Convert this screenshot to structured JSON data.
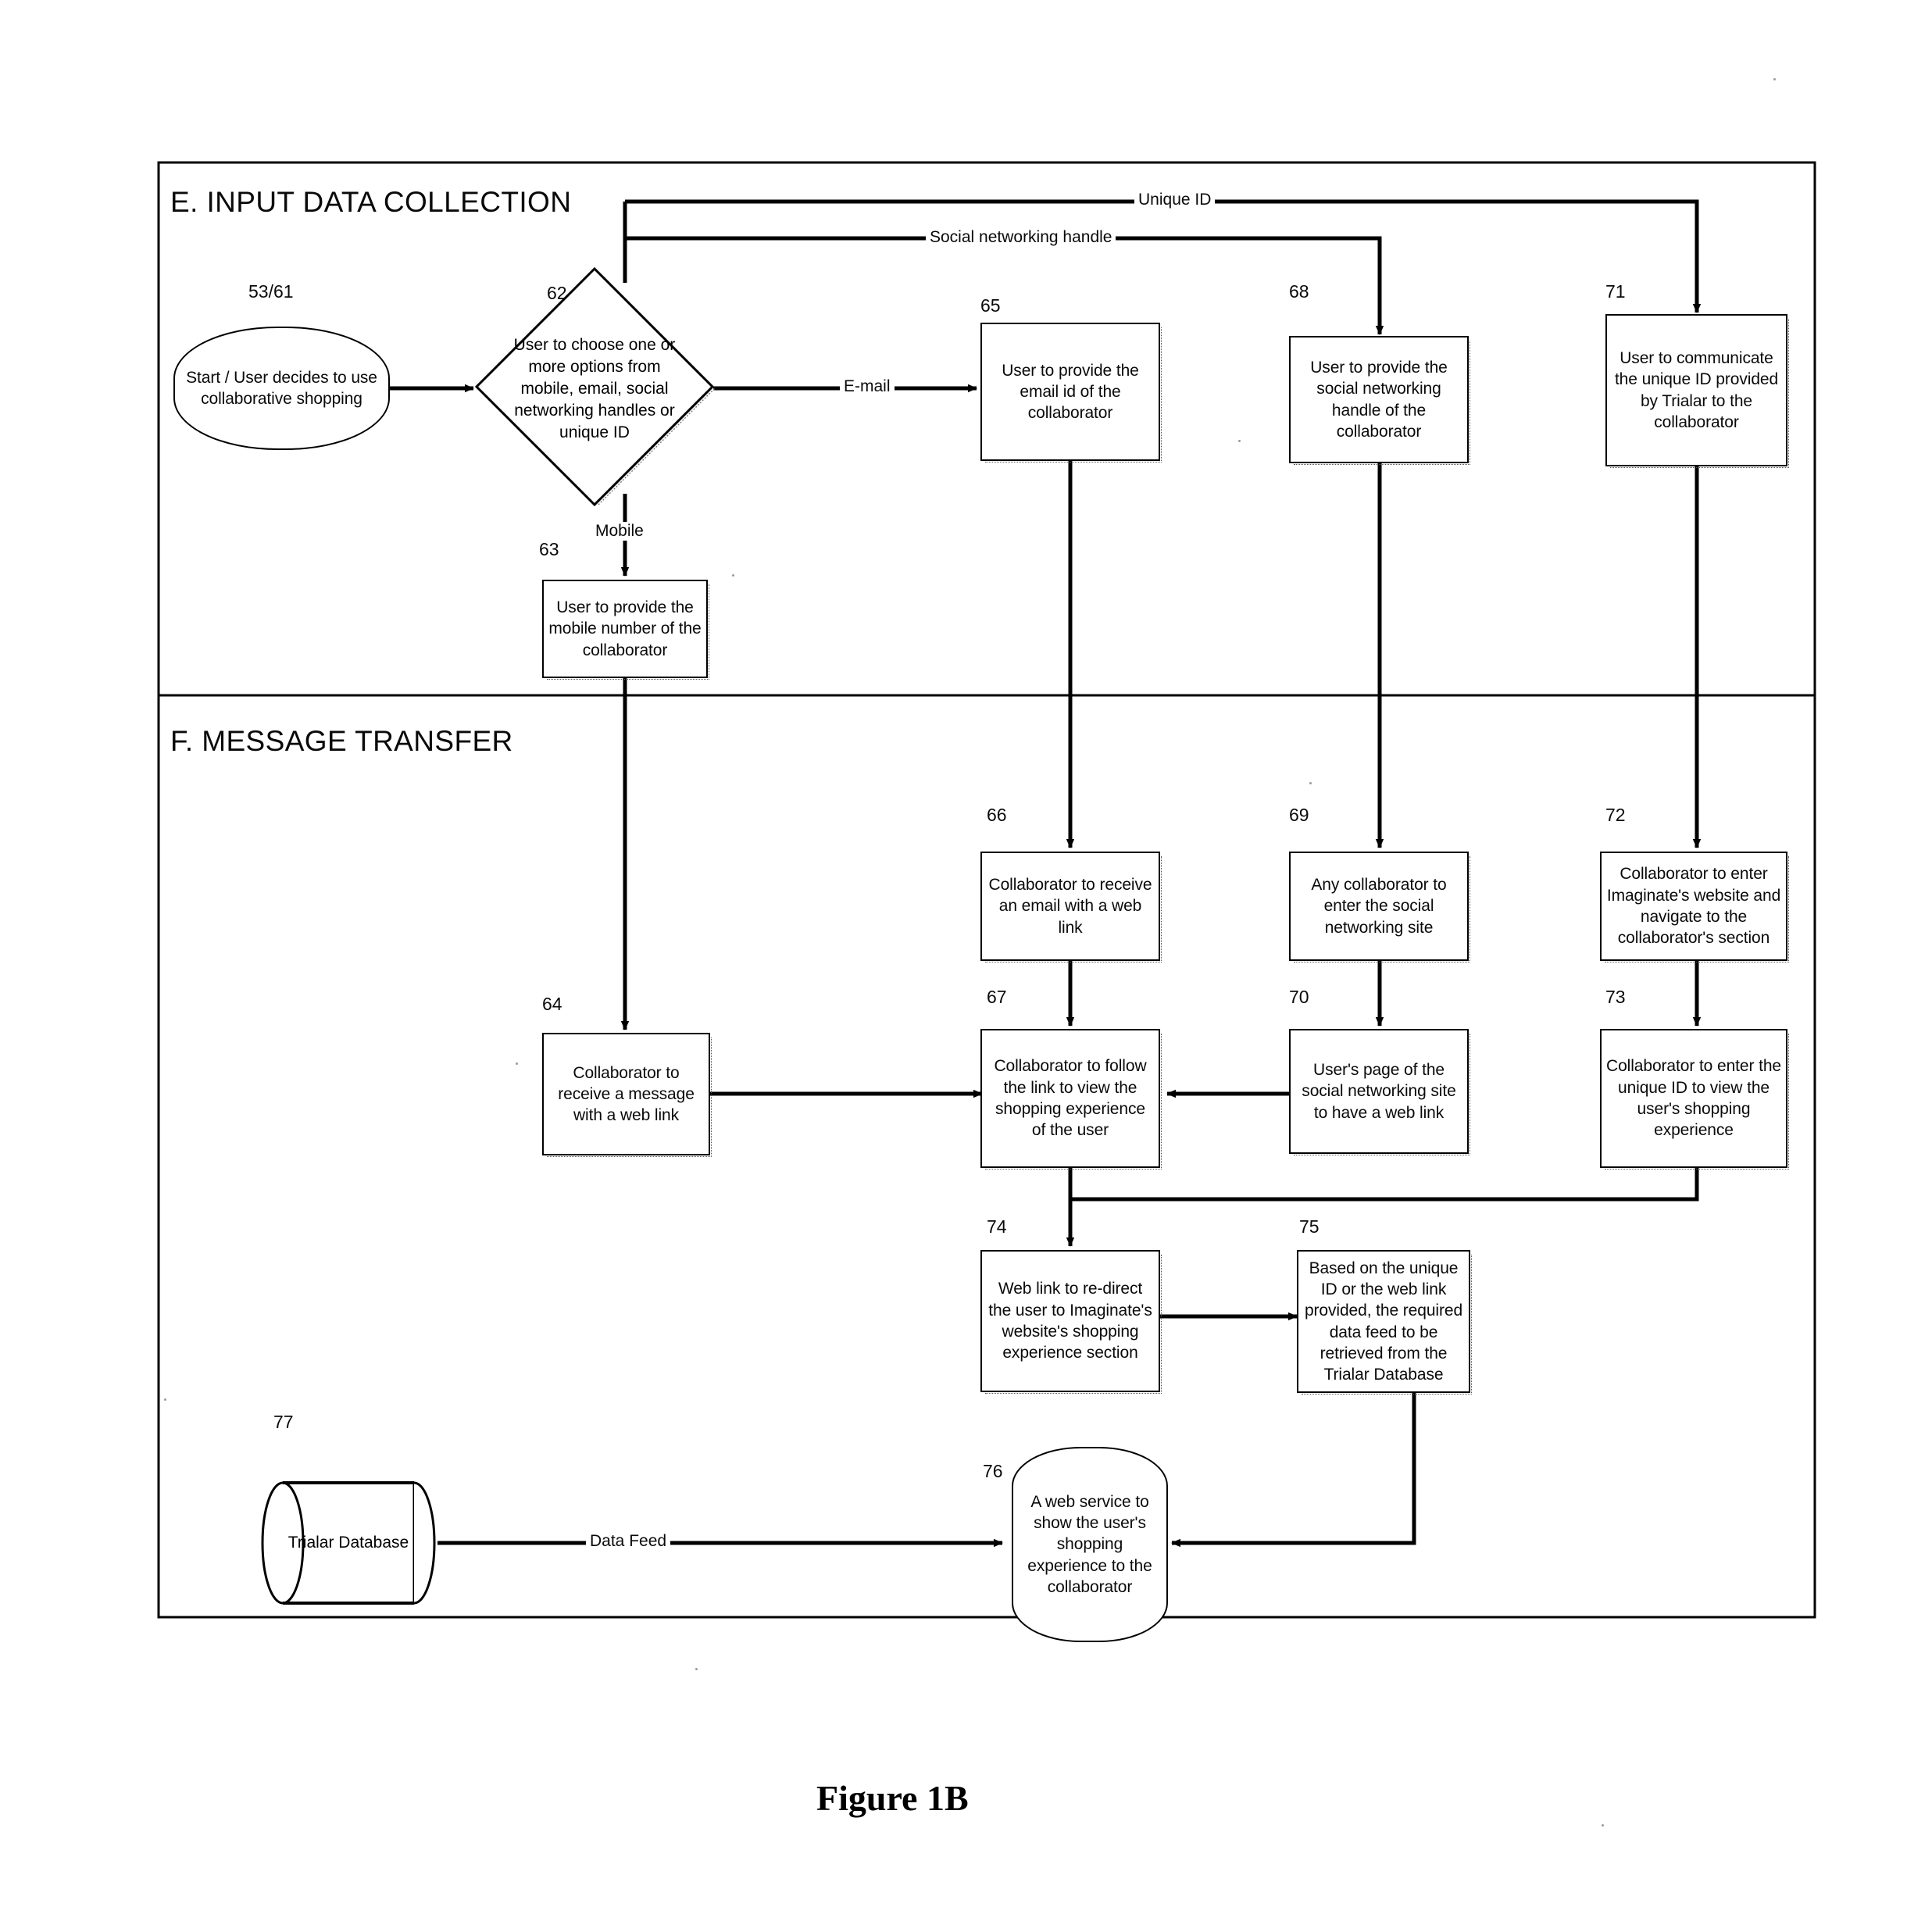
{
  "figure": {
    "caption": "Figure 1B"
  },
  "lanes": [
    {
      "id": "E",
      "title": "E. INPUT DATA COLLECTION"
    },
    {
      "id": "F",
      "title": "F. MESSAGE TRANSFER"
    }
  ],
  "nodes": [
    {
      "ref": "53/61",
      "shape": "terminator",
      "text": "Start / User decides to use collaborative shopping"
    },
    {
      "ref": "62",
      "shape": "decision",
      "text": "User to choose one or more options from mobile, email, social networking handles or unique ID"
    },
    {
      "ref": "63",
      "shape": "process",
      "text": "User to provide the mobile number of the collaborator"
    },
    {
      "ref": "65",
      "shape": "process",
      "text": "User to provide the email id of the collaborator"
    },
    {
      "ref": "68",
      "shape": "process",
      "text": "User to provide the social networking handle of the collaborator"
    },
    {
      "ref": "71",
      "shape": "process",
      "text": "User to communicate the unique ID provided by Trialar to the collaborator"
    },
    {
      "ref": "64",
      "shape": "process",
      "text": "Collaborator to receive a message with a web link"
    },
    {
      "ref": "66",
      "shape": "process",
      "text": "Collaborator to receive an email with a web link"
    },
    {
      "ref": "69",
      "shape": "process",
      "text": "Any collaborator to enter the social networking site"
    },
    {
      "ref": "72",
      "shape": "process",
      "text": "Collaborator to enter Imaginate's website and navigate to the collaborator's section"
    },
    {
      "ref": "67",
      "shape": "process",
      "text": "Collaborator to follow the link to view the shopping experience of the user"
    },
    {
      "ref": "70",
      "shape": "process",
      "text": "User's page of the social networking site to have a web link"
    },
    {
      "ref": "73",
      "shape": "process",
      "text": "Collaborator to enter the unique ID to view the user's shopping experience"
    },
    {
      "ref": "74",
      "shape": "process",
      "text": "Web link to re-direct the user to Imaginate's website's shopping experience section"
    },
    {
      "ref": "75",
      "shape": "process",
      "text": "Based on the unique ID or the web link provided, the required data feed to be retrieved from the Trialar Database"
    },
    {
      "ref": "76",
      "shape": "capsule",
      "text": "A web service to show the user's shopping experience to the collaborator"
    },
    {
      "ref": "77",
      "shape": "database",
      "text": "Trialar Database"
    }
  ],
  "edge_labels": [
    {
      "id": "unique-id",
      "text": "Unique ID"
    },
    {
      "id": "social-handle",
      "text": "Social networking handle"
    },
    {
      "id": "email",
      "text": "E-mail"
    },
    {
      "id": "mobile",
      "text": "Mobile"
    },
    {
      "id": "data-feed",
      "text": "Data Feed"
    }
  ],
  "colors": {
    "ink": "#000000",
    "paper": "#ffffff"
  }
}
